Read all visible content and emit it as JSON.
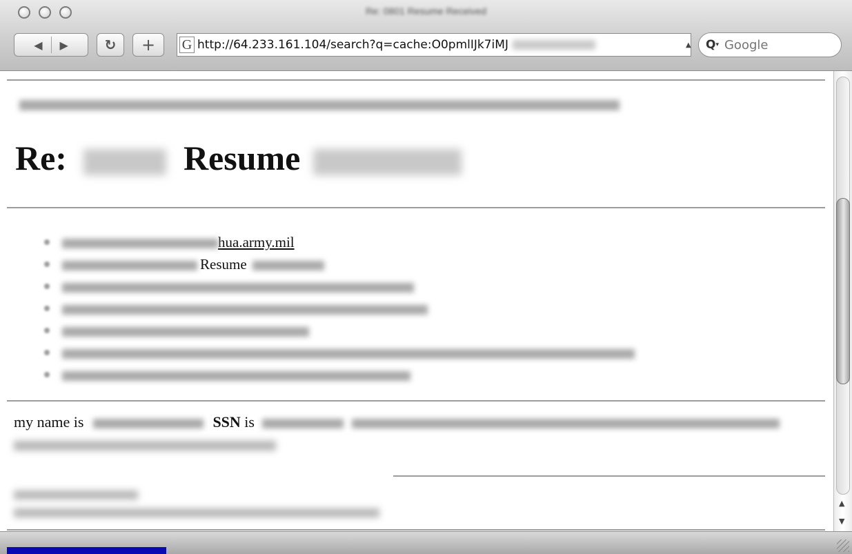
{
  "window": {
    "title": "Re: 0801 Resume Received"
  },
  "toolbar": {
    "back_glyph": "◀",
    "forward_glyph": "▶",
    "reload_glyph": "↻",
    "add_bookmark_glyph": "+",
    "address_icon_glyph": "G",
    "url": "http://64.233.161.104/search?q=cache:O0pmlIJk7iMJ",
    "search_placeholder": "Google",
    "search_glyph": "Q",
    "search_menu_glyph": "▾"
  },
  "page": {
    "heading_prefix": "Re:",
    "heading_word": "Resume",
    "meta": {
      "to_domain": "hua.army.mil",
      "subject_word": "Resume"
    },
    "body": {
      "prefix": "my name is",
      "ssn_label": "SSN",
      "is_word": "is"
    }
  },
  "status": {
    "progress": 0.19
  },
  "icons": [
    "back-icon",
    "forward-icon",
    "reload-icon",
    "add-bookmark-icon",
    "google-favicon",
    "search-icon",
    "resize-grip-icon"
  ]
}
